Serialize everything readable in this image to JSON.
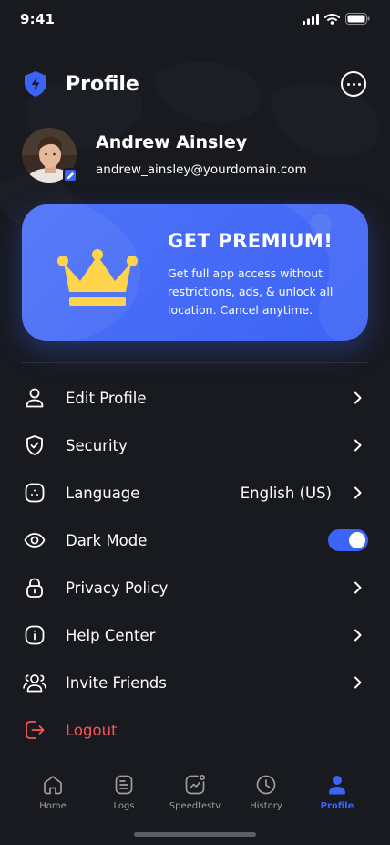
{
  "status_bar": {
    "time": "9:41"
  },
  "header": {
    "title": "Profile",
    "logo_icon": "shield-bolt-icon",
    "more_icon": "more-horizontal-icon"
  },
  "user": {
    "name": "Andrew Ainsley",
    "email": "andrew_ainsley@yourdomain.com"
  },
  "premium": {
    "title": "GET PREMIUM!",
    "description": "Get full app access without restrictions, ads, & unlock all location. Cancel anytime.",
    "icon": "crown-icon"
  },
  "menu": {
    "items": [
      {
        "label": "Edit Profile",
        "icon": "user-icon"
      },
      {
        "label": "Security",
        "icon": "shield-check-icon"
      },
      {
        "label": "Language",
        "icon": "language-icon",
        "value": "English (US)"
      },
      {
        "label": "Dark Mode",
        "icon": "eye-icon",
        "toggle_on": true
      },
      {
        "label": "Privacy Policy",
        "icon": "lock-icon"
      },
      {
        "label": "Help Center",
        "icon": "info-icon"
      },
      {
        "label": "Invite Friends",
        "icon": "users-icon"
      },
      {
        "label": "Logout",
        "icon": "logout-icon"
      }
    ]
  },
  "tabs": [
    {
      "label": "Home",
      "icon": "home-icon",
      "active": false
    },
    {
      "label": "Logs",
      "icon": "logs-icon",
      "active": false
    },
    {
      "label": "Speedtestv",
      "icon": "speedtest-icon",
      "active": false
    },
    {
      "label": "History",
      "icon": "clock-icon",
      "active": false
    },
    {
      "label": "Profile",
      "icon": "profile-icon",
      "active": true
    }
  ],
  "colors": {
    "background": "#181a20",
    "accent": "#3b63f6",
    "danger": "#f75555",
    "crown": "#ffd44d"
  }
}
